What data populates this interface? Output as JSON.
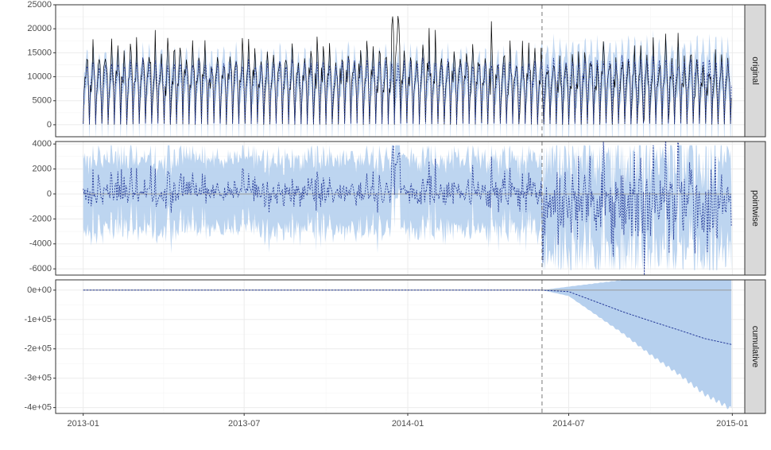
{
  "chart_data": {
    "type": "line",
    "layout": "faceted-vertical",
    "shared_x": {
      "range": [
        "2012-12-01",
        "2015-01-15"
      ],
      "tick_labels": [
        "2013-01",
        "2013-07",
        "2014-01",
        "2014-07",
        "2015-01"
      ],
      "tick_values": [
        "2013-01-01",
        "2013-07-01",
        "2014-01-01",
        "2014-07-01",
        "2015-01-01"
      ],
      "data_start": "2013-01-01",
      "data_end": "2014-12-31",
      "intervention_line": "2014-06-01"
    },
    "grid": true,
    "legend": "none",
    "panels": [
      {
        "strip_label": "original",
        "ylim": [
          -2500,
          25000
        ],
        "y_tick_values": [
          0,
          5000,
          10000,
          15000,
          20000,
          25000
        ],
        "y_tick_labels": [
          "0",
          "5000",
          "10000",
          "15000",
          "20000",
          "25000"
        ],
        "series_summary": {
          "observed_weekly_cycle": [
            0,
            7000,
            9500,
            10500,
            14000,
            12500,
            8500
          ],
          "observed_typical_range": [
            0,
            17000
          ],
          "observed_peak": {
            "date": "2013-12-20",
            "value": 22500
          },
          "prediction_typical_range": [
            4000,
            12000
          ],
          "interval_typical_range": [
            -1500,
            16000
          ]
        }
      },
      {
        "strip_label": "pointwise",
        "ylim": [
          -6500,
          4200
        ],
        "y_tick_values": [
          -6000,
          -4000,
          -2000,
          0,
          2000,
          4000
        ],
        "y_tick_labels": [
          "-6000",
          "-4000",
          "-2000",
          "0",
          "2000",
          "4000"
        ],
        "series_summary": {
          "effect_mean_pre": 0,
          "effect_mean_post": -1000,
          "effect_typical_range": [
            -2500,
            1500
          ],
          "interval_typical_range": [
            -6000,
            3800
          ]
        }
      },
      {
        "strip_label": "cumulative",
        "ylim": [
          -420000,
          35000
        ],
        "y_tick_values": [
          0,
          -100000,
          -200000,
          -300000,
          -400000
        ],
        "y_tick_labels": [
          "0e+00",
          "-1e+05",
          "-2e+05",
          "-3e+05",
          "-4e+05"
        ],
        "series": [
          {
            "role": "cumulative effect (dashed)",
            "points": [
              [
                "2013-01-01",
                0
              ],
              [
                "2014-06-01",
                0
              ],
              [
                "2014-07-01",
                -5000
              ],
              [
                "2014-08-01",
                -40000
              ],
              [
                "2014-09-01",
                -75000
              ],
              [
                "2014-10-01",
                -105000
              ],
              [
                "2014-11-01",
                -135000
              ],
              [
                "2014-12-01",
                -165000
              ],
              [
                "2014-12-31",
                -185000
              ]
            ]
          },
          {
            "role": "interval upper",
            "points": [
              [
                "2014-06-01",
                0
              ],
              [
                "2014-07-01",
                12000
              ],
              [
                "2014-09-01",
                35000
              ],
              [
                "2014-11-01",
                50000
              ],
              [
                "2014-12-31",
                65000
              ]
            ]
          },
          {
            "role": "interval lower",
            "points": [
              [
                "2014-06-01",
                0
              ],
              [
                "2014-07-01",
                -20000
              ],
              [
                "2014-08-01",
                -85000
              ],
              [
                "2014-09-01",
                -150000
              ],
              [
                "2014-10-01",
                -220000
              ],
              [
                "2014-11-01",
                -285000
              ],
              [
                "2014-12-01",
                -355000
              ],
              [
                "2014-12-31",
                -405000
              ]
            ]
          }
        ]
      }
    ],
    "colors": {
      "interval_fill": "#b6d0ee",
      "observed_line": "#000000",
      "prediction_line": "#283d9a",
      "zero_line": "#999999",
      "vline": "#777777",
      "strip_fill": "#d9d9d9",
      "grid_major": "#ebebeb",
      "grid_minor": "#f5f5f5",
      "axis_text": "#4d4d4d"
    }
  }
}
